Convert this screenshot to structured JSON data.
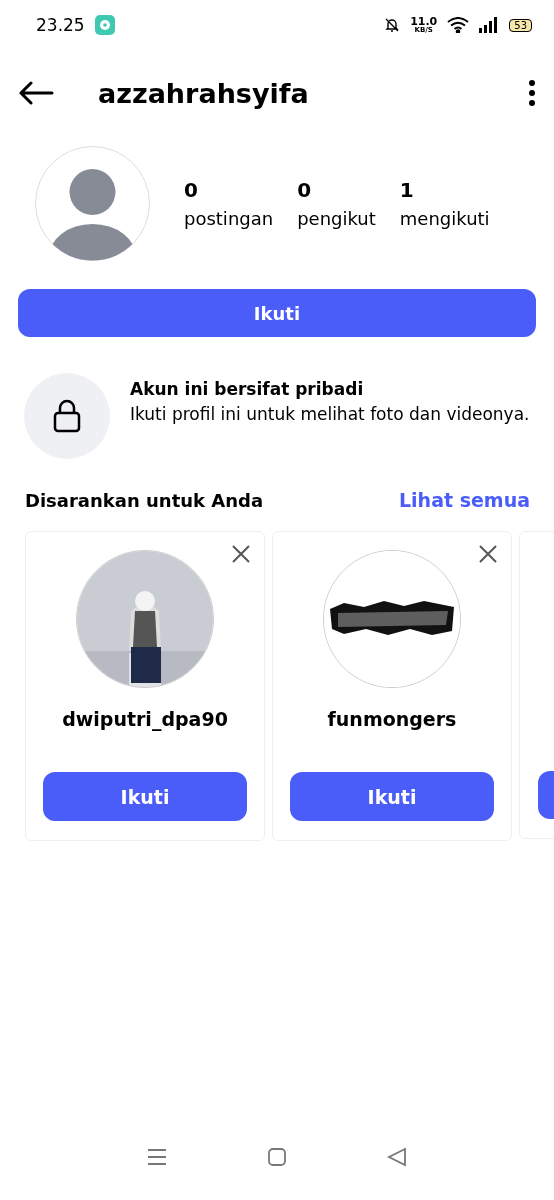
{
  "status_bar": {
    "time": "23.25",
    "speed_value": "11.0",
    "speed_unit": "KB/S",
    "battery": "53"
  },
  "header": {
    "username": "azzahrahsyifa"
  },
  "stats": [
    {
      "value": "0",
      "label": "postingan"
    },
    {
      "value": "0",
      "label": "pengikut"
    },
    {
      "value": "1",
      "label": "mengikuti"
    }
  ],
  "follow_button": "Ikuti",
  "private_notice": {
    "title": "Akun ini bersifat pribadi",
    "text": "Ikuti profil ini untuk melihat foto dan videonya."
  },
  "suggestions": {
    "title": "Disarankan untuk Anda",
    "see_all": "Lihat semua",
    "cards": [
      {
        "kind": "full",
        "name": "dwiputri_dpa90",
        "button": "Ikuti"
      },
      {
        "kind": "full",
        "name": "funmongers",
        "button": "Ikuti"
      },
      {
        "kind": "cut"
      }
    ]
  }
}
